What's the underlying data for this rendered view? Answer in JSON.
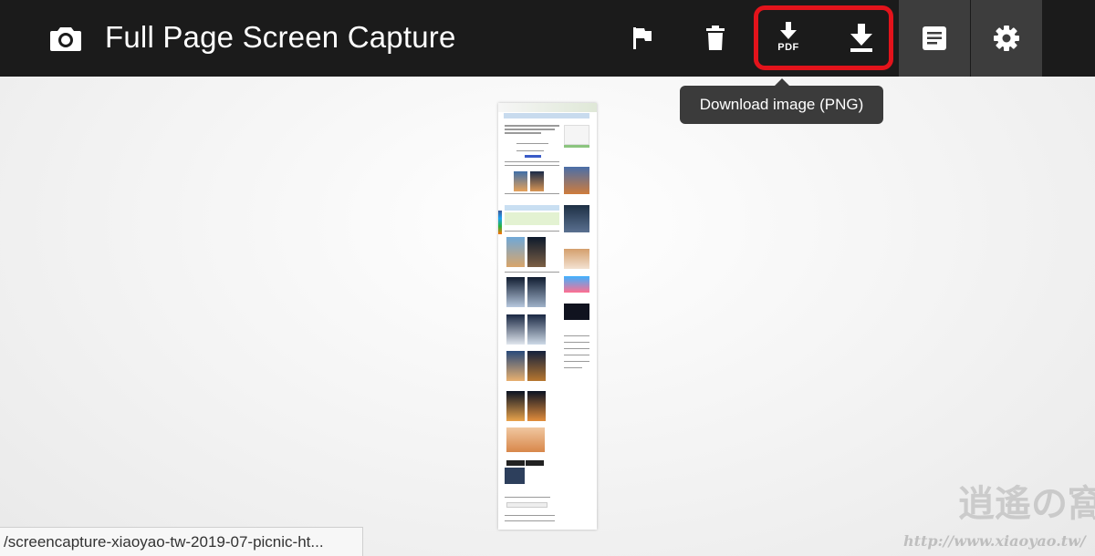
{
  "app": {
    "title": "Full Page Screen Capture",
    "logo_icon": "camera-icon"
  },
  "toolbar": {
    "buttons": [
      {
        "name": "flag-button",
        "icon": "flag-icon"
      },
      {
        "name": "delete-button",
        "icon": "trash-icon"
      },
      {
        "name": "download-pdf-button",
        "icon": "download-icon",
        "label": "PDF"
      },
      {
        "name": "download-png-button",
        "icon": "download-icon"
      },
      {
        "name": "notes-button",
        "icon": "notes-icon"
      },
      {
        "name": "settings-button",
        "icon": "gear-icon"
      }
    ],
    "highlight_color": "#e3131b"
  },
  "tooltip": {
    "text": "Download image (PNG)"
  },
  "statusbar": {
    "url": "/screencapture-xiaoyao-tw-2019-07-picnic-ht..."
  },
  "watermark": {
    "logo_text": "逍遙の窩",
    "url_text": "http://www.xiaoyao.tw/"
  },
  "colors": {
    "topbar_bg": "#1b1b1b",
    "active_button_bg": "#3d3d3d",
    "tooltip_bg": "#3b3b3b"
  }
}
